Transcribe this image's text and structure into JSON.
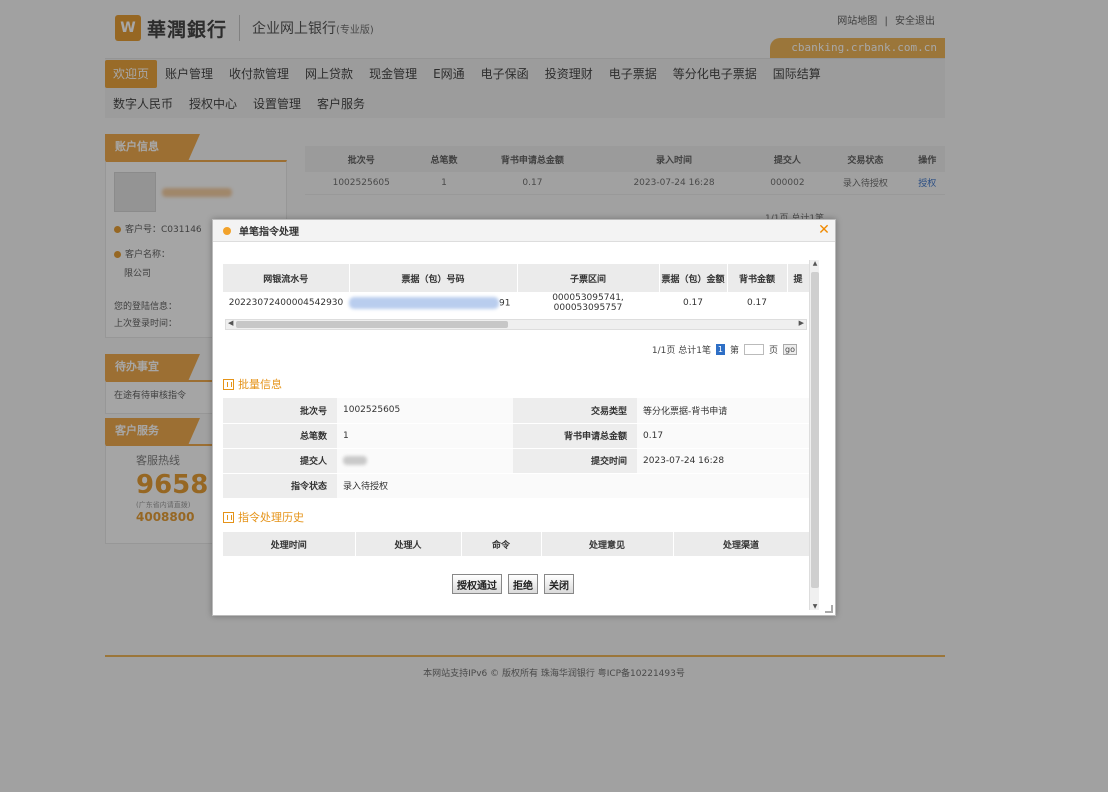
{
  "header": {
    "logo_mark": "W",
    "bank_name": "華潤銀行",
    "product_title": "企业网上银行",
    "product_sub": "(专业版)",
    "site_map": "网站地图",
    "sep": "|",
    "safe_exit": "安全退出",
    "url": "cbanking.crbank.com.cn"
  },
  "nav": {
    "row1": [
      "欢迎页",
      "账户管理",
      "收付款管理",
      "网上贷款",
      "现金管理",
      "E网通",
      "电子保函",
      "投资理财",
      "电子票据",
      "等分化电子票据",
      "国际结算"
    ],
    "row2": [
      "数字人民币",
      "授权中心",
      "设置管理",
      "客户服务"
    ]
  },
  "sidebar": {
    "account_head": "账户信息",
    "customer_no_label": "客户号：",
    "customer_no_value": "C031146",
    "customer_name_label": "客户名称：",
    "company_suffix": "限公司",
    "last_login_label": "您的登陆信息：",
    "last_time_label": "上次登录时间：",
    "todo_head": "待办事宜",
    "todo_item": "在途有待审核指令",
    "service_head": "客户服务",
    "hotline_label": "客服热线",
    "hotline_num": "9658",
    "hotline_sub": "(广东省内请直拨)",
    "hotline_num2": "4008800"
  },
  "batch_table": {
    "headers": [
      "批次号",
      "总笔数",
      "背书申请总金额",
      "录入时间",
      "提交人",
      "交易状态",
      "操作"
    ],
    "rows": [
      [
        "1002525605",
        "1",
        "0.17",
        "2023-07-24 16:28",
        "000002",
        "录入待授权",
        "授权"
      ]
    ],
    "pager_text": "1/1页 总计1笔"
  },
  "modal": {
    "title": "单笔指令处理",
    "close": "✕",
    "detail_headers": [
      "网银流水号",
      "票据（包）号码",
      "子票区间",
      "票据（包）金额",
      "背书金额",
      "提"
    ],
    "detail_row": [
      "20223072400004542930",
      "",
      "000053095741, 000053095757",
      "0.17",
      "0.17",
      ""
    ],
    "detail_row_suffix": "91",
    "pager": {
      "summary": "1/1页 总计1笔",
      "current": "1",
      "page_label": "第",
      "page_unit": "页",
      "go": "go"
    },
    "batch_section": "批量信息",
    "info": {
      "batch_no_label": "批次号",
      "batch_no": "1002525605",
      "trade_type_label": "交易类型",
      "trade_type": "等分化票据-背书申请",
      "total_count_label": "总笔数",
      "total_count": "1",
      "total_amount_label": "背书申请总金额",
      "total_amount": "0.17",
      "submitter_label": "提交人",
      "submit_time_label": "提交时间",
      "submit_time": "2023-07-24 16:28",
      "status_label": "指令状态",
      "status": "录入待授权"
    },
    "history_section": "指令处理历史",
    "history_headers": [
      "处理时间",
      "处理人",
      "命令",
      "处理意见",
      "处理渠道"
    ],
    "buttons": {
      "approve": "授权通过",
      "reject": "拒绝",
      "close": "关闭"
    }
  },
  "footer": {
    "text": "本网站支持IPv6  © 版权所有 珠海华润银行 粤ICP备10221493号"
  },
  "colors": {
    "accent": "#e59318",
    "link": "#1f5fbf"
  }
}
